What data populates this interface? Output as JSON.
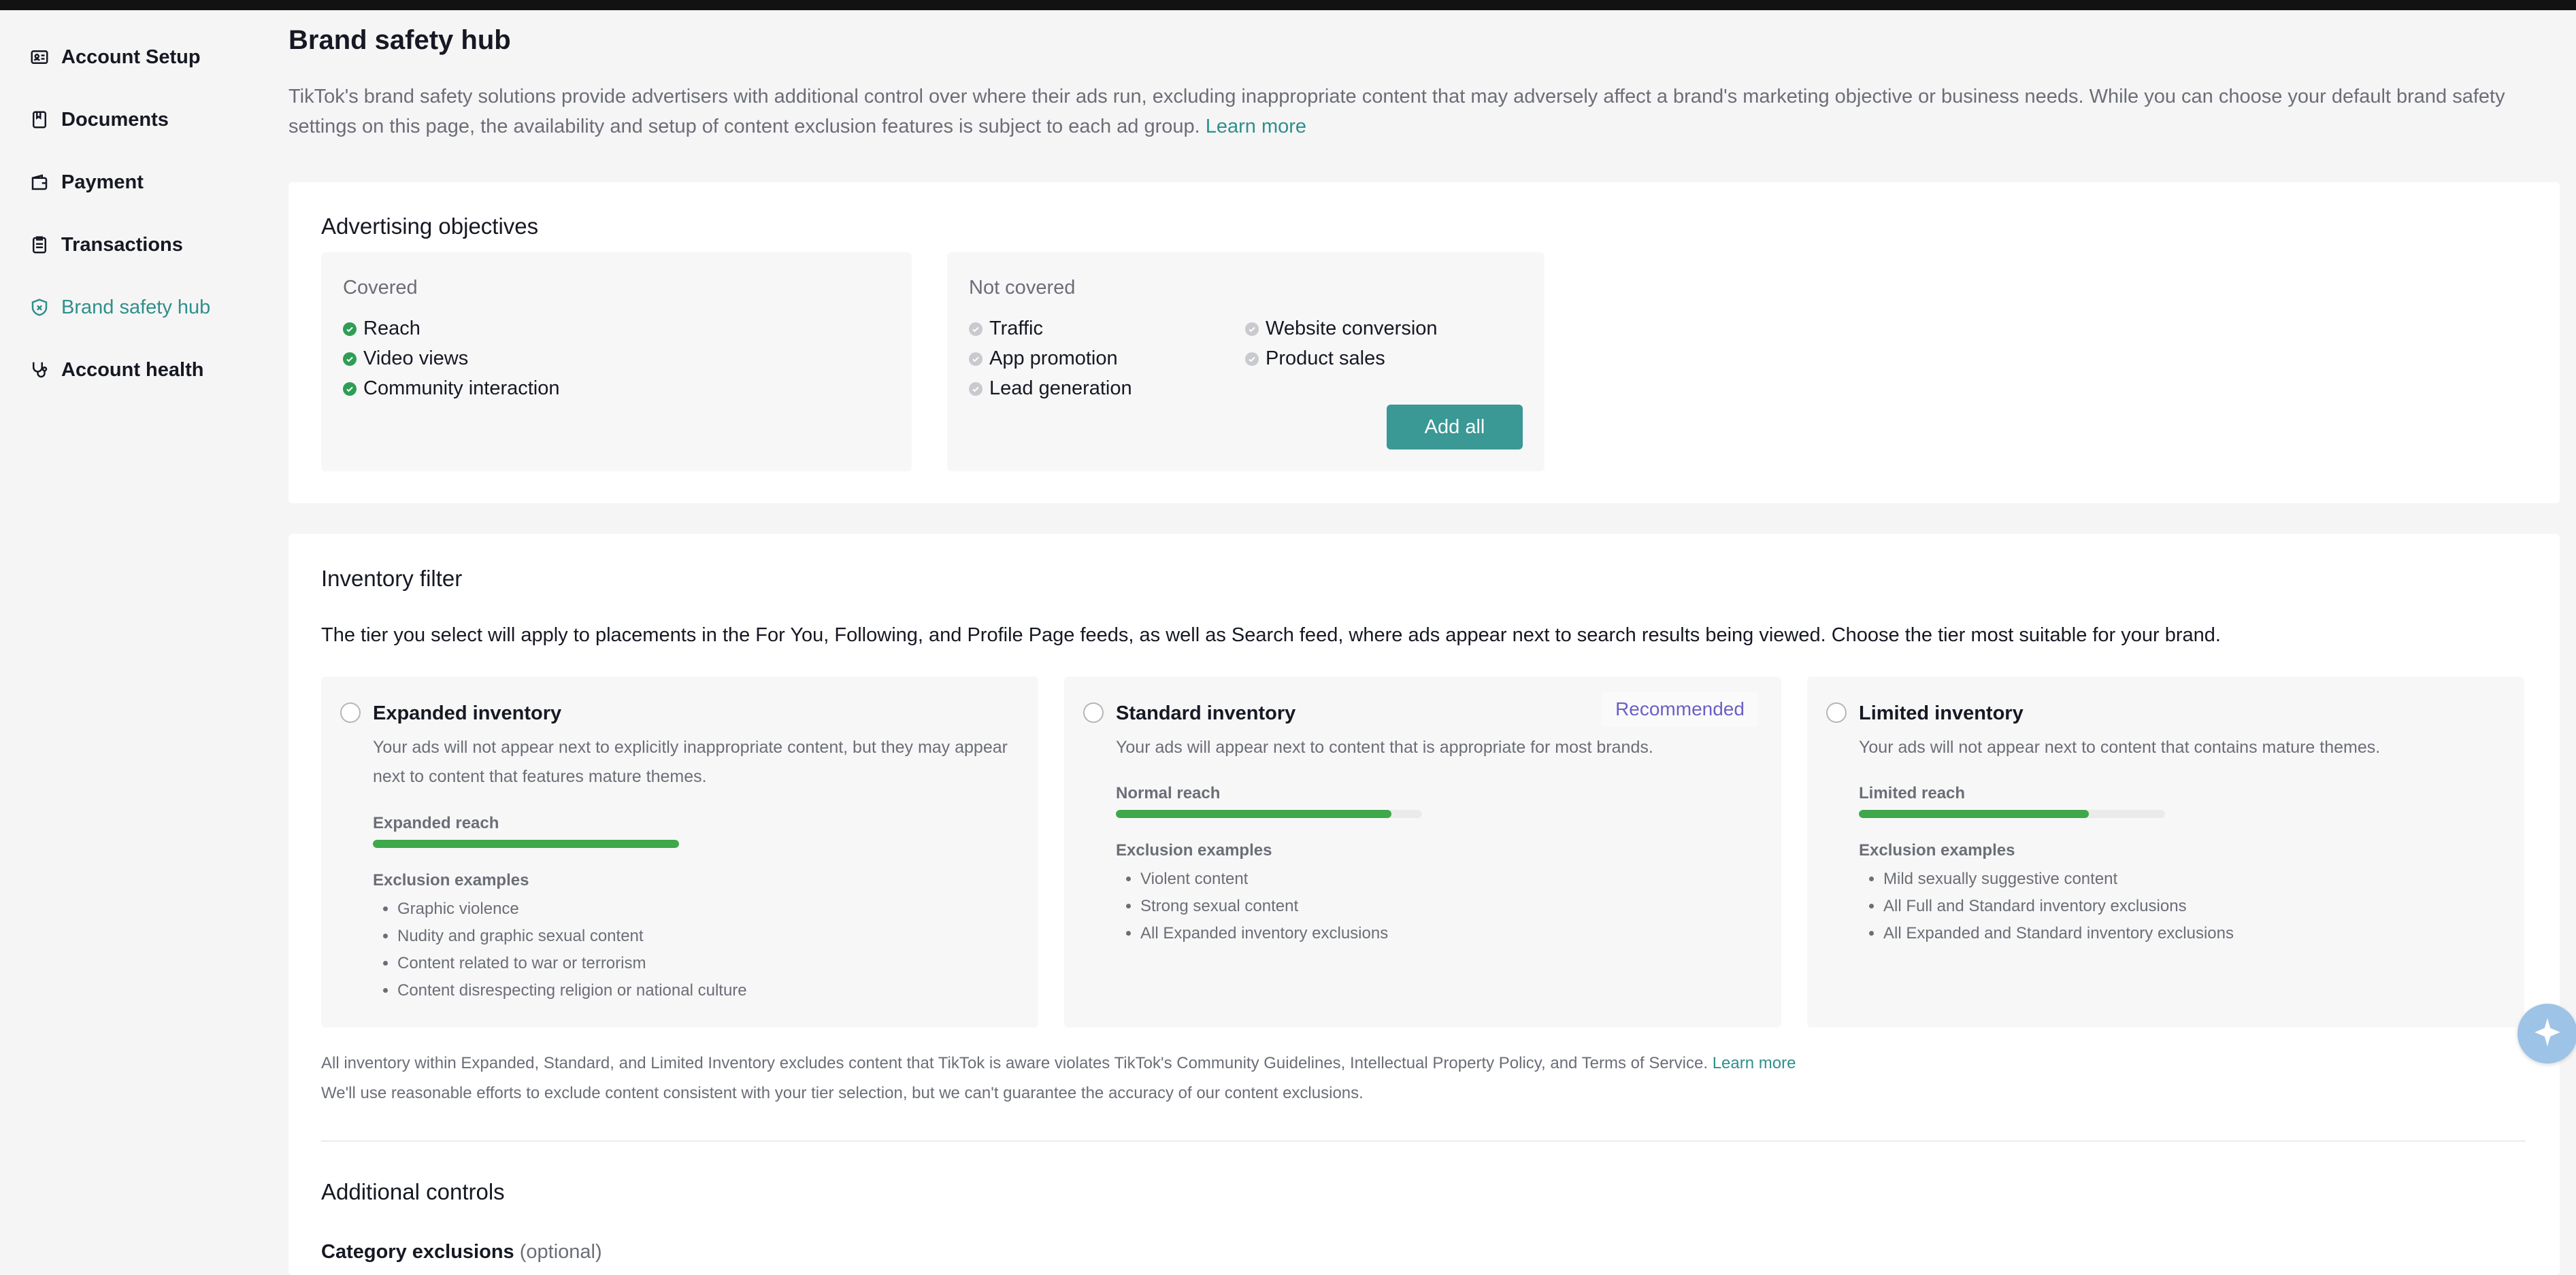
{
  "sidebar": {
    "items": [
      {
        "label": "Account Setup",
        "icon": "id-card-icon"
      },
      {
        "label": "Documents",
        "icon": "document-icon"
      },
      {
        "label": "Payment",
        "icon": "wallet-icon"
      },
      {
        "label": "Transactions",
        "icon": "receipt-icon"
      },
      {
        "label": "Brand safety hub",
        "icon": "shield-icon",
        "active": true
      },
      {
        "label": "Account health",
        "icon": "stethoscope-icon"
      }
    ]
  },
  "page": {
    "title": "Brand safety hub",
    "intro": "TikTok's brand safety solutions provide advertisers with additional control over where their ads run, excluding inappropriate content that may adversely affect a brand's marketing objective or business needs. While you can choose your default brand safety settings on this page, the availability and setup of content exclusion features is subject to each ad group.",
    "intro_link": "Learn more"
  },
  "objectives": {
    "title": "Advertising objectives",
    "covered_title": "Covered",
    "covered": [
      "Reach",
      "Video views",
      "Community interaction"
    ],
    "not_covered_title": "Not covered",
    "not_covered": [
      "Traffic",
      "App promotion",
      "Lead generation",
      "Website conversion",
      "Product sales"
    ],
    "add_all_label": "Add all"
  },
  "inventory": {
    "title": "Inventory filter",
    "description": "The tier you select will apply to placements in the For You, Following, and Profile Page feeds, as well as Search feed, where ads appear next to search results being viewed. Choose the tier most suitable for your brand.",
    "exclusion_title": "Exclusion examples",
    "tiers": [
      {
        "name": "Expanded inventory",
        "desc": "Your ads will not appear next to explicitly inappropriate content, but they may appear next to content that features mature themes.",
        "reach_label": "Expanded reach",
        "reach": 1.0,
        "exclusions": [
          "Graphic violence",
          "Nudity and graphic sexual content",
          "Content related to war or terrorism",
          "Content disrespecting religion or national culture"
        ]
      },
      {
        "name": "Standard inventory",
        "badge": "Recommended",
        "desc": "Your ads will appear next to content that is appropriate for most brands.",
        "reach_label": "Normal reach",
        "reach": 0.9,
        "exclusions": [
          "Violent content",
          "Strong sexual content",
          "All Expanded inventory exclusions"
        ]
      },
      {
        "name": "Limited inventory",
        "desc": "Your ads will not appear next to content that contains mature themes.",
        "reach_label": "Limited reach",
        "reach": 0.75,
        "exclusions": [
          "Mild sexually suggestive content",
          "All Full and Standard inventory exclusions",
          "All Expanded and Standard inventory exclusions"
        ]
      }
    ],
    "footnote1": "All inventory within Expanded, Standard, and Limited Inventory excludes content that TikTok is aware violates TikTok's Community Guidelines, Intellectual Property Policy, and Terms of Service.",
    "footnote1_link": "Learn more",
    "footnote2": "We'll use reasonable efforts to exclude content consistent with your tier selection, but we can't guarantee the accuracy of our content exclusions."
  },
  "additional": {
    "title": "Additional controls",
    "category_label": "Category exclusions",
    "category_optional": "(optional)"
  },
  "colors": {
    "accent": "#2f8f8c",
    "check": "#2e9e55",
    "bar": "#3ea84a",
    "badge": "#6a5fc7"
  }
}
